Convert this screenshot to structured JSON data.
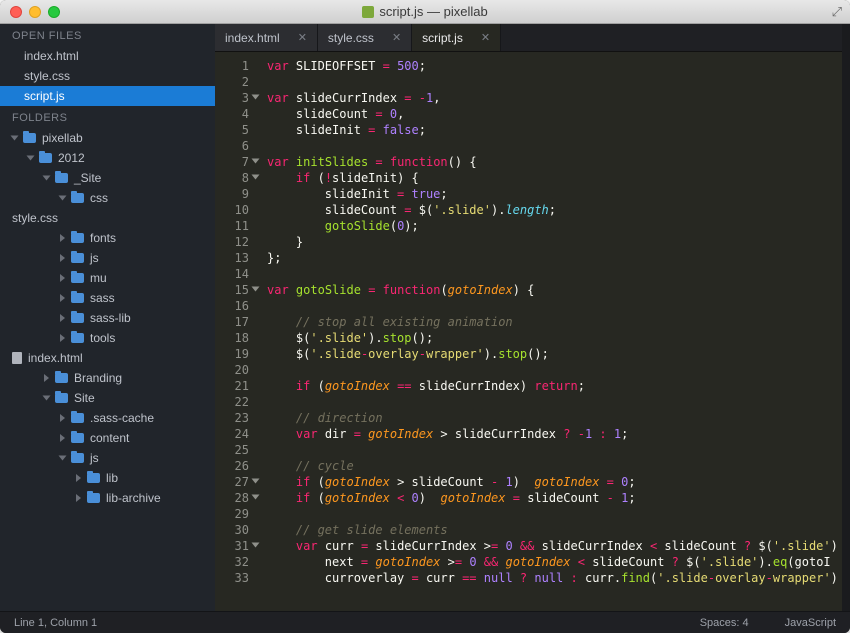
{
  "window": {
    "title": "script.js — pixellab"
  },
  "sidebar": {
    "heading_open_files": "OPEN FILES",
    "heading_folders": "FOLDERS",
    "open_files": [
      {
        "label": "index.html"
      },
      {
        "label": "style.css"
      },
      {
        "label": "script.js",
        "selected": true
      }
    ],
    "tree": {
      "root": "pixellab",
      "y2012": "2012",
      "site": "_Site",
      "css": "css",
      "css_file": "style.css",
      "fonts": "fonts",
      "js": "js",
      "mu": "mu",
      "sass": "sass",
      "sasslib": "sass-lib",
      "tools": "tools",
      "indexhtml": "index.html",
      "branding": "Branding",
      "siteCap": "Site",
      "sasscache": ".sass-cache",
      "content": "content",
      "js2": "js",
      "lib": "lib",
      "libarchive": "lib-archive"
    }
  },
  "tabs": [
    {
      "label": "index.html"
    },
    {
      "label": "style.css"
    },
    {
      "label": "script.js",
      "active": true
    }
  ],
  "code_lines": [
    "var SLIDEOFFSET = 500;",
    "",
    "var slideCurrIndex = -1,",
    "    slideCount = 0,",
    "    slideInit = false;",
    "",
    "var initSlides = function() {",
    "    if (!slideInit) {",
    "        slideInit = true;",
    "        slideCount = $('.slide').length;",
    "        gotoSlide(0);",
    "    }",
    "};",
    "",
    "var gotoSlide = function(gotoIndex) {",
    "",
    "    // stop all existing animation",
    "    $('.slide').stop();",
    "    $('.slide-overlay-wrapper').stop();",
    "",
    "    if (gotoIndex == slideCurrIndex) return;",
    "",
    "    // direction",
    "    var dir = gotoIndex > slideCurrIndex ? -1 : 1;",
    "",
    "    // cycle",
    "    if (gotoIndex > slideCount - 1)  gotoIndex = 0;",
    "    if (gotoIndex < 0)  gotoIndex = slideCount - 1;",
    "",
    "    // get slide elements",
    "    var curr = slideCurrIndex >= 0 && slideCurrIndex < slideCount ? $('.slide')",
    "        next = gotoIndex >= 0 && gotoIndex < slideCount ? $('.slide').eq(gotoI",
    "        curroverlay = curr == null ? null : curr.find('.slide-overlay-wrapper')"
  ],
  "status": {
    "left": "Line 1, Column 1",
    "spaces": "Spaces: 4",
    "lang": "JavaScript"
  }
}
